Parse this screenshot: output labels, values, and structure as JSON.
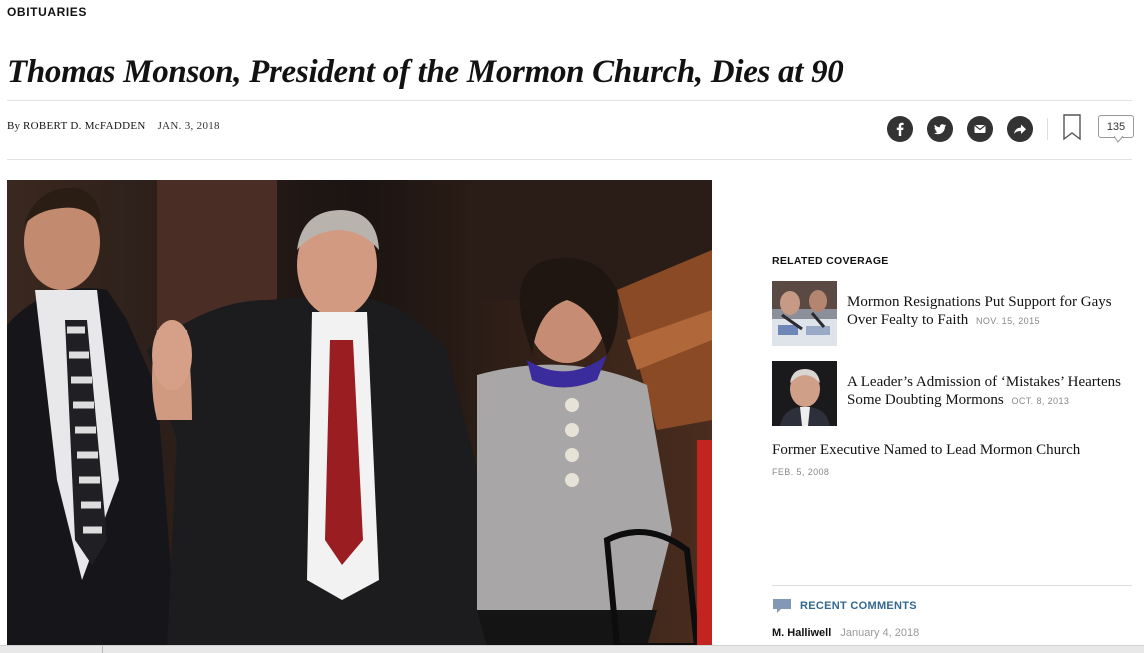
{
  "section": {
    "kicker": "OBITUARIES"
  },
  "article": {
    "headline": "Thomas Monson, President of the Mormon Church, Dies at 90",
    "byline_prefix": "By",
    "author": "ROBERT D. McFADDEN",
    "date": "JAN. 3, 2018"
  },
  "share": {
    "icons": [
      "facebook-icon",
      "twitter-icon",
      "email-icon",
      "share-icon",
      "bookmark-icon",
      "comments-icon"
    ],
    "comment_count": "135"
  },
  "related": {
    "title": "RELATED COVERAGE",
    "items": [
      {
        "title": "Mormon Resignations Put Support for Gays Over Fealty to Faith",
        "date": "NOV. 15, 2015"
      },
      {
        "title": "A Leader’s Admission of ‘Mistakes’ Heartens Some Doubting Mormons",
        "date": "OCT. 8, 2013"
      },
      {
        "title": "Former Executive Named to Lead Mormon Church",
        "date": "FEB. 5, 2008"
      }
    ]
  },
  "comments": {
    "title": "RECENT COMMENTS",
    "latest": {
      "name": "M. Halliwell",
      "date": "January 4, 2018"
    }
  }
}
